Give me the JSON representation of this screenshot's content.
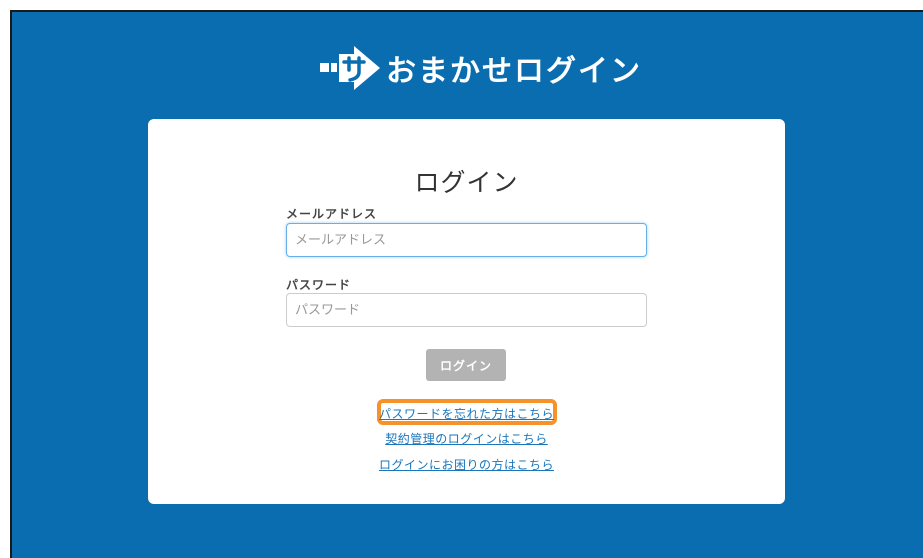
{
  "brand": {
    "text": "おまかせログイン",
    "logo_icon": "brand-arrow-logo-icon"
  },
  "login_card": {
    "title": "ログイン",
    "email": {
      "label": "メールアドレス",
      "placeholder": "メールアドレス",
      "value": ""
    },
    "password": {
      "label": "パスワード",
      "placeholder": "パスワード",
      "value": ""
    },
    "submit_label": "ログイン",
    "links": {
      "forgot_password": "パスワードを忘れた方はこちら",
      "contract_login": "契約管理のログインはこちら",
      "trouble_login": "ログインにお困りの方はこちら"
    }
  },
  "colors": {
    "background": "#0a6db0",
    "card": "#ffffff",
    "button_disabled": "#b3b3b3",
    "link": "#1a75bb",
    "highlight": "#f5922a",
    "input_focus": "#66afe9"
  }
}
